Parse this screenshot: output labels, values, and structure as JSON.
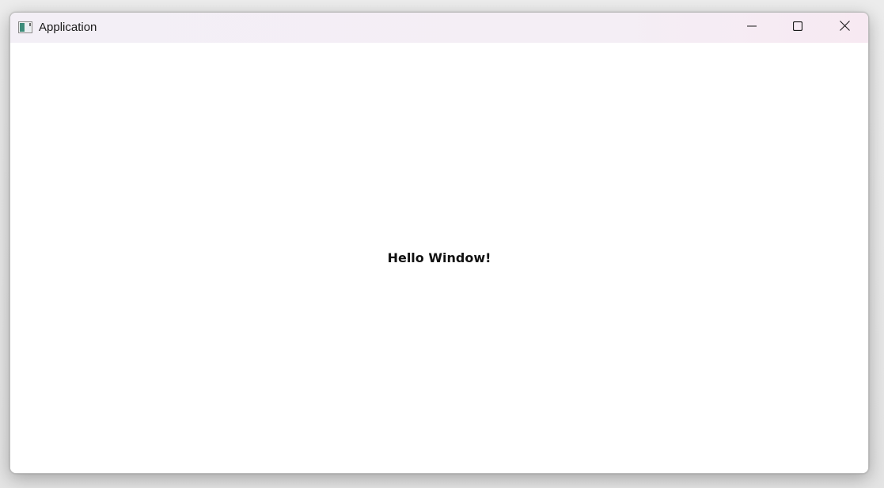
{
  "window": {
    "title": "Application",
    "icon": "application-window-icon",
    "controls": {
      "minimize": "minimize-icon",
      "maximize": "maximize-icon",
      "close": "close-icon"
    }
  },
  "content": {
    "message": "Hello Window!"
  }
}
